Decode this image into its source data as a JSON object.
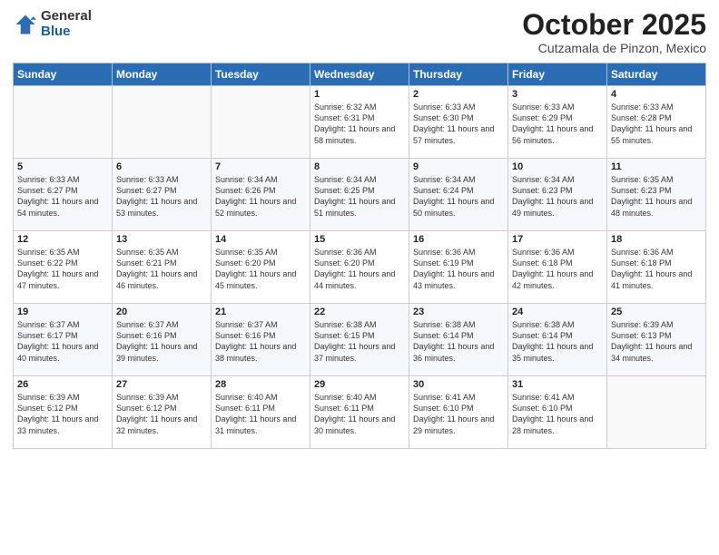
{
  "header": {
    "logo_general": "General",
    "logo_blue": "Blue",
    "month_title": "October 2025",
    "location": "Cutzamala de Pinzon, Mexico"
  },
  "weekdays": [
    "Sunday",
    "Monday",
    "Tuesday",
    "Wednesday",
    "Thursday",
    "Friday",
    "Saturday"
  ],
  "weeks": [
    [
      {
        "day": "",
        "info": ""
      },
      {
        "day": "",
        "info": ""
      },
      {
        "day": "",
        "info": ""
      },
      {
        "day": "1",
        "info": "Sunrise: 6:32 AM\nSunset: 6:31 PM\nDaylight: 11 hours and 58 minutes."
      },
      {
        "day": "2",
        "info": "Sunrise: 6:33 AM\nSunset: 6:30 PM\nDaylight: 11 hours and 57 minutes."
      },
      {
        "day": "3",
        "info": "Sunrise: 6:33 AM\nSunset: 6:29 PM\nDaylight: 11 hours and 56 minutes."
      },
      {
        "day": "4",
        "info": "Sunrise: 6:33 AM\nSunset: 6:28 PM\nDaylight: 11 hours and 55 minutes."
      }
    ],
    [
      {
        "day": "5",
        "info": "Sunrise: 6:33 AM\nSunset: 6:27 PM\nDaylight: 11 hours and 54 minutes."
      },
      {
        "day": "6",
        "info": "Sunrise: 6:33 AM\nSunset: 6:27 PM\nDaylight: 11 hours and 53 minutes."
      },
      {
        "day": "7",
        "info": "Sunrise: 6:34 AM\nSunset: 6:26 PM\nDaylight: 11 hours and 52 minutes."
      },
      {
        "day": "8",
        "info": "Sunrise: 6:34 AM\nSunset: 6:25 PM\nDaylight: 11 hours and 51 minutes."
      },
      {
        "day": "9",
        "info": "Sunrise: 6:34 AM\nSunset: 6:24 PM\nDaylight: 11 hours and 50 minutes."
      },
      {
        "day": "10",
        "info": "Sunrise: 6:34 AM\nSunset: 6:23 PM\nDaylight: 11 hours and 49 minutes."
      },
      {
        "day": "11",
        "info": "Sunrise: 6:35 AM\nSunset: 6:23 PM\nDaylight: 11 hours and 48 minutes."
      }
    ],
    [
      {
        "day": "12",
        "info": "Sunrise: 6:35 AM\nSunset: 6:22 PM\nDaylight: 11 hours and 47 minutes."
      },
      {
        "day": "13",
        "info": "Sunrise: 6:35 AM\nSunset: 6:21 PM\nDaylight: 11 hours and 46 minutes."
      },
      {
        "day": "14",
        "info": "Sunrise: 6:35 AM\nSunset: 6:20 PM\nDaylight: 11 hours and 45 minutes."
      },
      {
        "day": "15",
        "info": "Sunrise: 6:36 AM\nSunset: 6:20 PM\nDaylight: 11 hours and 44 minutes."
      },
      {
        "day": "16",
        "info": "Sunrise: 6:36 AM\nSunset: 6:19 PM\nDaylight: 11 hours and 43 minutes."
      },
      {
        "day": "17",
        "info": "Sunrise: 6:36 AM\nSunset: 6:18 PM\nDaylight: 11 hours and 42 minutes."
      },
      {
        "day": "18",
        "info": "Sunrise: 6:36 AM\nSunset: 6:18 PM\nDaylight: 11 hours and 41 minutes."
      }
    ],
    [
      {
        "day": "19",
        "info": "Sunrise: 6:37 AM\nSunset: 6:17 PM\nDaylight: 11 hours and 40 minutes."
      },
      {
        "day": "20",
        "info": "Sunrise: 6:37 AM\nSunset: 6:16 PM\nDaylight: 11 hours and 39 minutes."
      },
      {
        "day": "21",
        "info": "Sunrise: 6:37 AM\nSunset: 6:16 PM\nDaylight: 11 hours and 38 minutes."
      },
      {
        "day": "22",
        "info": "Sunrise: 6:38 AM\nSunset: 6:15 PM\nDaylight: 11 hours and 37 minutes."
      },
      {
        "day": "23",
        "info": "Sunrise: 6:38 AM\nSunset: 6:14 PM\nDaylight: 11 hours and 36 minutes."
      },
      {
        "day": "24",
        "info": "Sunrise: 6:38 AM\nSunset: 6:14 PM\nDaylight: 11 hours and 35 minutes."
      },
      {
        "day": "25",
        "info": "Sunrise: 6:39 AM\nSunset: 6:13 PM\nDaylight: 11 hours and 34 minutes."
      }
    ],
    [
      {
        "day": "26",
        "info": "Sunrise: 6:39 AM\nSunset: 6:12 PM\nDaylight: 11 hours and 33 minutes."
      },
      {
        "day": "27",
        "info": "Sunrise: 6:39 AM\nSunset: 6:12 PM\nDaylight: 11 hours and 32 minutes."
      },
      {
        "day": "28",
        "info": "Sunrise: 6:40 AM\nSunset: 6:11 PM\nDaylight: 11 hours and 31 minutes."
      },
      {
        "day": "29",
        "info": "Sunrise: 6:40 AM\nSunset: 6:11 PM\nDaylight: 11 hours and 30 minutes."
      },
      {
        "day": "30",
        "info": "Sunrise: 6:41 AM\nSunset: 6:10 PM\nDaylight: 11 hours and 29 minutes."
      },
      {
        "day": "31",
        "info": "Sunrise: 6:41 AM\nSunset: 6:10 PM\nDaylight: 11 hours and 28 minutes."
      },
      {
        "day": "",
        "info": ""
      }
    ]
  ]
}
